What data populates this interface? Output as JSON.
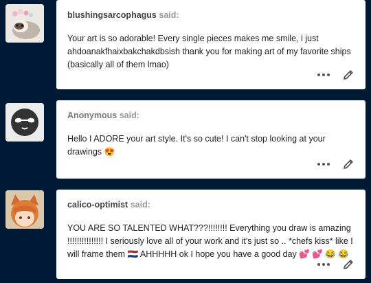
{
  "asks": [
    {
      "asker": "blushingsarcophagus",
      "said": "said:",
      "text": "Your art is so adorable! Every single pieces makes me smile, i just ahdoanakfhaixbakchakdbsish thank you for making art of my favorite ships (basically all of them lmao)",
      "avatar_icon": "ferret-with-flower-crown-icon"
    },
    {
      "asker": "Anonymous",
      "said": "said:",
      "text": "Hello I ADORE your art style. It's so cute! I can't stop looking at your drawings 😍",
      "avatar_icon": "sunglasses-anon-icon"
    },
    {
      "asker": "calico-optimist",
      "said": "said:",
      "text": "YOU ARE SO TALENTED WHAT???!!!!!!!! Everything you draw is amazing !!!!!!!!!!!!!!! I seriously love all of your work and it's just so .. *chefs kiss* like I will frame them 🇳🇱 AHHHHH ok I hope you have a good day 💕 💕 😂 😂",
      "avatar_icon": "anime-cat-ear-character-icon"
    }
  ],
  "colors": {
    "background": "#001935",
    "card": "#ffffff"
  },
  "action_icons": [
    "more-options-icon",
    "edit-pencil-icon"
  ]
}
